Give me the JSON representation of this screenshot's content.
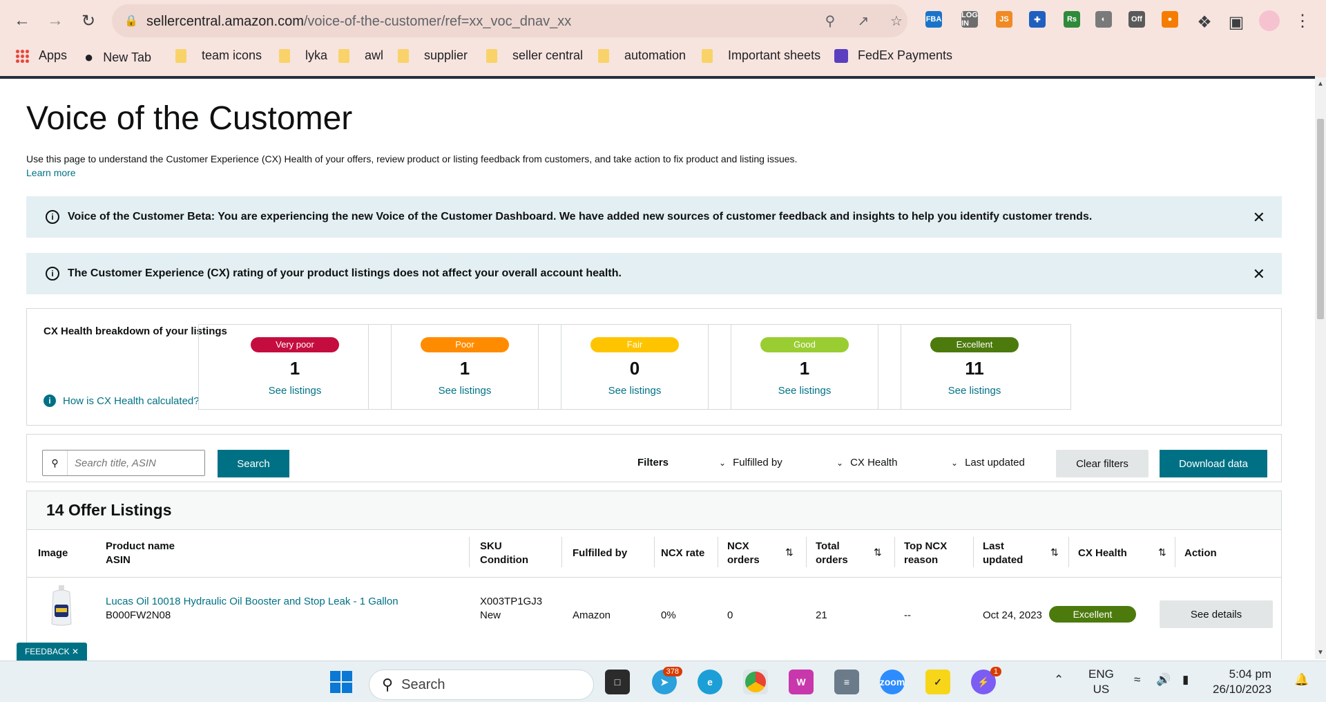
{
  "browser": {
    "url_host": "sellercentral.amazon.com",
    "url_path": "/voice-of-the-customer/ref=xx_voc_dnav_xx",
    "extensions": [
      {
        "name": "fba-extension-icon",
        "label": "FBA",
        "color": "#1a73c8"
      },
      {
        "name": "login-extension-icon",
        "label": "LOG IN",
        "color": "#6d6d6d"
      },
      {
        "name": "js-extension-icon",
        "label": "JS",
        "color": "#f08a24"
      },
      {
        "name": "blue-star-extension-icon",
        "label": "✚",
        "color": "#1f5fbf"
      },
      {
        "name": "rs-extension-icon",
        "label": "Rs",
        "color": "#2f8a3c"
      },
      {
        "name": "helium-extension-icon",
        "label": "◐",
        "color": "#7a7a7a"
      },
      {
        "name": "off-extension-icon",
        "label": "Off",
        "color": "#5a5a5a"
      },
      {
        "name": "orange-circle-extension-icon",
        "label": "●",
        "color": "#f57c00"
      }
    ],
    "bookmarks": [
      {
        "label": "Apps",
        "type": "apps"
      },
      {
        "label": "New Tab",
        "type": "globe"
      },
      {
        "label": "team icons",
        "type": "folder"
      },
      {
        "label": "lyka",
        "type": "folder"
      },
      {
        "label": "awl",
        "type": "folder"
      },
      {
        "label": "supplier",
        "type": "folder"
      },
      {
        "label": "seller central",
        "type": "folder"
      },
      {
        "label": "automation",
        "type": "folder"
      },
      {
        "label": "Important sheets",
        "type": "folder"
      },
      {
        "label": "FedEx Payments",
        "type": "sheet"
      }
    ]
  },
  "page": {
    "title": "Voice of the Customer",
    "description": "Use this page to understand the Customer Experience (CX) Health of your offers, review product or listing feedback from customers, and take action to fix product and listing issues.",
    "learn_more": "Learn more",
    "alerts": [
      "Voice of the Customer Beta: You are experiencing the new Voice of the Customer Dashboard. We have added new sources of customer feedback and insights to help you identify customer trends.",
      "The Customer Experience (CX) rating of your product listings does not affect your overall account health."
    ],
    "cx": {
      "label": "CX Health breakdown of your listings",
      "help": "How is CX Health calculated?",
      "cards": [
        {
          "badge": "Very poor",
          "count": "1",
          "link": "See listings",
          "color": "#c40d3e"
        },
        {
          "badge": "Poor",
          "count": "1",
          "link": "See listings",
          "color": "#ff8c00"
        },
        {
          "badge": "Fair",
          "count": "0",
          "link": "See listings",
          "color": "#ffc400"
        },
        {
          "badge": "Good",
          "count": "1",
          "link": "See listings",
          "color": "#9acd32"
        },
        {
          "badge": "Excellent",
          "count": "11",
          "link": "See listings",
          "color": "#4c7a0c"
        }
      ]
    },
    "filters": {
      "search_placeholder": "Search title, ASIN",
      "search_button": "Search",
      "filters_label": "Filters",
      "fulfilled_by": "Fulfilled by",
      "cx_health": "CX Health",
      "last_updated": "Last updated",
      "clear": "Clear filters",
      "download": "Download data"
    },
    "table": {
      "title": "14 Offer Listings",
      "headers": {
        "image": "Image",
        "product_name": "Product name",
        "asin": "ASIN",
        "sku": "SKU",
        "condition": "Condition",
        "fulfilled_by": "Fulfilled by",
        "ncx_rate": "NCX rate",
        "ncx_orders_1": "NCX",
        "ncx_orders_2": "orders",
        "total_orders_1": "Total",
        "total_orders_2": "orders",
        "top_ncx_1": "Top NCX",
        "top_ncx_2": "reason",
        "last_updated_1": "Last",
        "last_updated_2": "updated",
        "cx_health": "CX Health",
        "action": "Action"
      },
      "rows": [
        {
          "product_name": "Lucas Oil 10018 Hydraulic Oil Booster and Stop Leak - 1 Gallon",
          "asin": "B000FW2N08",
          "sku": "X003TP1GJ3",
          "condition": "New",
          "fulfilled_by": "Amazon",
          "ncx_rate": "0%",
          "ncx_orders": "0",
          "total_orders": "21",
          "top_ncx_reason": "--",
          "last_updated": "Oct 24, 2023",
          "cx_health": "Excellent",
          "action": "See details"
        }
      ]
    },
    "feedback": "FEEDBACK"
  },
  "taskbar": {
    "search": "Search",
    "telegram_badge": "378",
    "messenger_badge": "1",
    "lang_1": "ENG",
    "lang_2": "US",
    "time": "5:04 pm",
    "date": "26/10/2023"
  }
}
